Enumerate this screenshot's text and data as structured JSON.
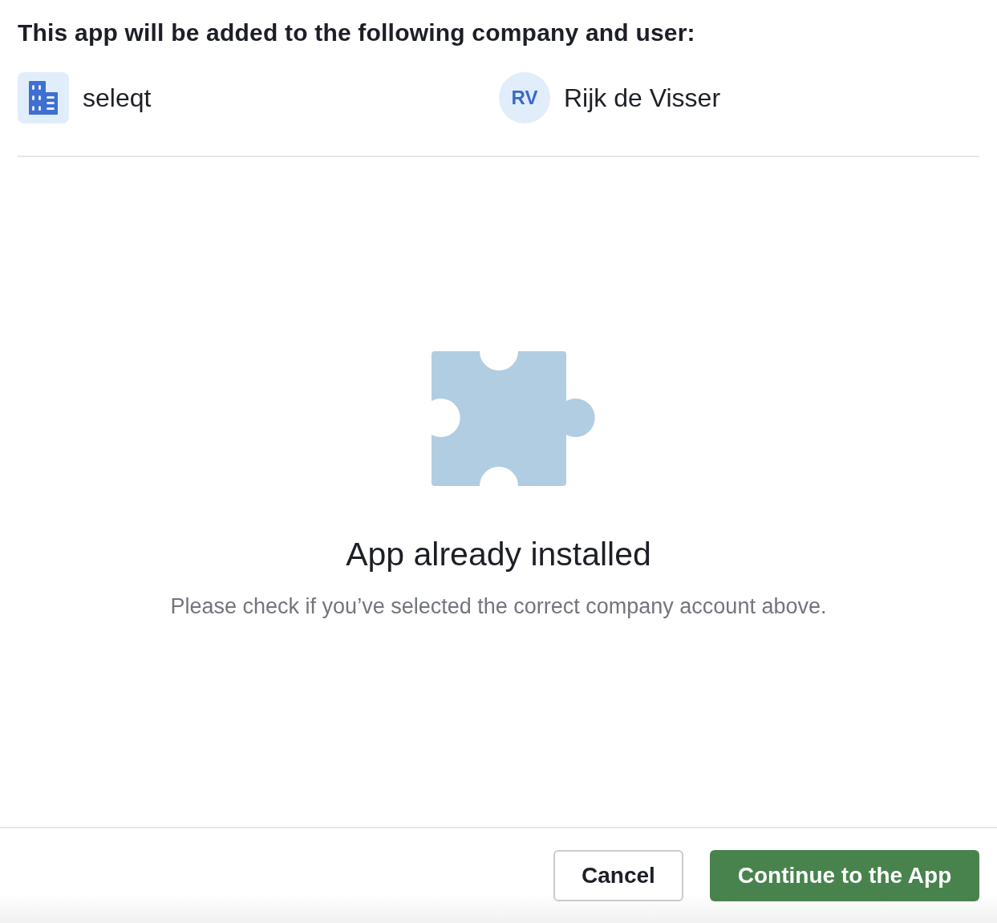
{
  "heading": "This app will be added to the following company and user:",
  "company": {
    "name": "seleqt"
  },
  "user": {
    "initials": "RV",
    "name": "Rijk de Visser"
  },
  "status": {
    "title": "App already installed",
    "message": "Please check if you’ve selected the correct company account above."
  },
  "buttons": [
    {
      "label": "Cancel",
      "kind": "secondary"
    },
    {
      "label": "Continue to the App",
      "kind": "primary"
    }
  ]
}
